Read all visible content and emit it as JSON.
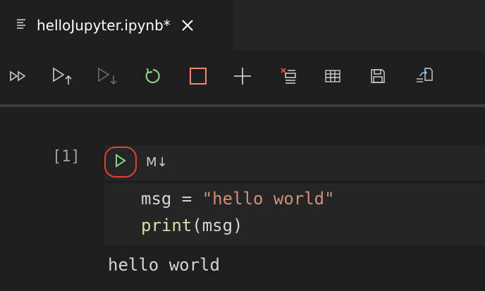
{
  "tab": {
    "icon": "notebook-file-icon",
    "title": "helloJupyter.ipynb*",
    "close_icon": "close-icon"
  },
  "toolbar": {
    "buttons": [
      {
        "name": "run-all-button",
        "icon": "run-all-icon"
      },
      {
        "name": "run-above-button",
        "icon": "run-above-icon"
      },
      {
        "name": "run-below-button",
        "icon": "run-below-icon",
        "disabled": true
      },
      {
        "name": "restart-kernel-button",
        "icon": "restart-icon",
        "color": "#89d185"
      },
      {
        "name": "interrupt-kernel-button",
        "icon": "stop-icon",
        "color": "#f48771"
      },
      {
        "name": "add-cell-button",
        "icon": "plus-icon"
      },
      {
        "name": "clear-outputs-button",
        "icon": "clear-outputs-icon"
      },
      {
        "name": "variables-button",
        "icon": "table-icon"
      },
      {
        "name": "save-button",
        "icon": "save-icon"
      },
      {
        "name": "export-button",
        "icon": "export-icon"
      }
    ]
  },
  "cell": {
    "execution_count": "[1]",
    "run_icon": "play-icon",
    "cell_type_label": "M↓",
    "code": {
      "line1": {
        "var": "msg",
        "op": " = ",
        "str": "\"hello world\""
      },
      "line2": {
        "fn": "print",
        "rest": "(msg)"
      }
    },
    "output": "hello world"
  },
  "colors": {
    "background": "#1e1e1e",
    "cell_background": "#252526",
    "run_green": "#89d185",
    "highlight_red": "#e0412f",
    "string": "#ce9178",
    "function": "#dcdcaa"
  }
}
